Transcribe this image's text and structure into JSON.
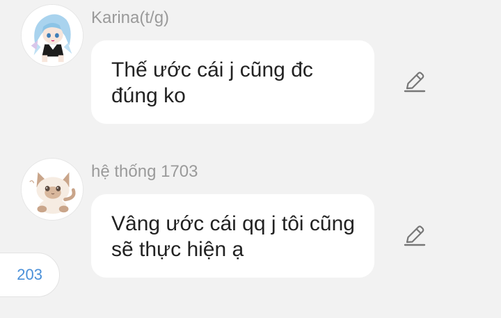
{
  "messages": [
    {
      "sender": "Karina(t/g)",
      "avatar_icon": "anime-girl-avatar-icon",
      "text": "Thế ước cái j cũng đc đúng ko",
      "edit_icon": "pencil-edit-icon"
    },
    {
      "sender": "hệ thống 1703",
      "avatar_icon": "cat-avatar-icon",
      "text": "Vâng ước cái qq j tôi cũng sẽ thực hiện ạ",
      "edit_icon": "pencil-edit-icon"
    }
  ],
  "counter": {
    "value": "203"
  },
  "colors": {
    "background": "#f2f2f2",
    "bubble": "#ffffff",
    "sender_text": "#9a9a9a",
    "message_text": "#222222",
    "counter_text": "#4a90d9",
    "icon": "#777777"
  }
}
